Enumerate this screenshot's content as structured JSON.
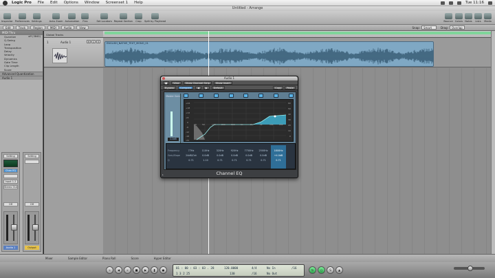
{
  "menubar": {
    "items": [
      "Logic Pro",
      "File",
      "Edit",
      "Options",
      "Window",
      "Screenset 1",
      "Help"
    ],
    "clock": "Tue 11:16"
  },
  "window": {
    "title": "Untitled - Arrange"
  },
  "toolbar": {
    "left": [
      "Inspector",
      "Preferences",
      "Settings",
      "Auto Zoom",
      "Automation",
      "Flex",
      "Set Locators",
      "Repeat Section",
      "Crop",
      "Split by Playhead"
    ],
    "right": [
      "Bounce",
      "Colors",
      "Notes",
      "Lists",
      "Media"
    ]
  },
  "local_menus": [
    "Edit",
    "Track",
    "Region",
    "MIDI",
    "Audio",
    "View"
  ],
  "snap": {
    "snap_label": "Snap:",
    "snap_value": "Smart",
    "drag_label": "Drag:",
    "drag_value": "Overlap"
  },
  "inspector": {
    "header": "MIDI Thru",
    "params": [
      {
        "label": "Quantize",
        "value": "off (3840)"
      },
      {
        "label": "Q-Swing",
        "value": ""
      },
      {
        "label": "Loop",
        "value": ""
      },
      {
        "label": "Transposition",
        "value": ""
      },
      {
        "label": "Delay",
        "value": ""
      },
      {
        "label": "Velocity",
        "value": ""
      },
      {
        "label": "Dynamics",
        "value": ""
      },
      {
        "label": "Gate Time",
        "value": ""
      },
      {
        "label": "Clip Length",
        "value": ""
      },
      {
        "label": "Score",
        "value": ""
      }
    ],
    "advanced": "Advanced Quantization",
    "track_section": "Audio 1",
    "strip1": {
      "setting": "Setting",
      "eq": "Chan EQ",
      "io": "Input 1-2",
      "group": "Stereo Out",
      "off": "Off",
      "name": "Audio 1"
    },
    "strip2": {
      "setting": "Setting",
      "off": "Off",
      "name": "Output"
    }
  },
  "arrange": {
    "tracklist_title": "Global Tracks",
    "track": {
      "number": "1",
      "name": "Audio 1",
      "mute": "M",
      "solo": "S",
      "rec": "R"
    },
    "region_name": "ENGLISH_NATIVE_TEXT_MONO_01"
  },
  "plugin": {
    "title": "Audio 1",
    "row1": [
      "View",
      "Show Channel Strip",
      "Show Insert"
    ],
    "row2": [
      "Bypass",
      "Compare",
      "Default"
    ],
    "row2_right": [
      "Copy",
      "Paste"
    ],
    "master_label": "Master Gain",
    "master_value": "0.0dB",
    "analyzer": "Analyzer",
    "analyzer2": "post EQ",
    "analyzer3": "Lock",
    "db_left": [
      "+24",
      "+18",
      "+12",
      "+6",
      "0",
      "-6",
      "-12",
      "-18",
      "-24"
    ],
    "db_right": [
      "60",
      "50",
      "40",
      "30",
      "20",
      "10",
      "0"
    ],
    "freq": [
      "20",
      "50",
      "100",
      "200",
      "500",
      "1k",
      "2k",
      "5k",
      "10k",
      "20k"
    ],
    "row_labels": [
      "Frequency",
      "Gain/Slope",
      "Q"
    ],
    "bands": [
      {
        "f": "77Hz",
        "g": "24dB/Oct",
        "q": "0.71"
      },
      {
        "f": "110Hz",
        "g": "0.0dB",
        "q": "1.10"
      },
      {
        "f": "320Hz",
        "g": "0.0dB",
        "q": "0.71"
      },
      {
        "f": "920Hz",
        "g": "0.0dB",
        "q": "0.71"
      },
      {
        "f": "7750Hz",
        "g": "0.0dB",
        "q": "0.71"
      },
      {
        "f": "2500Hz",
        "g": "0.0dB",
        "q": "0.71"
      },
      {
        "f": "1800Hz",
        "g": "+4.0dB",
        "q": "0.71"
      },
      {
        "f": "",
        "g": "",
        "q": ""
      }
    ],
    "name": "Channel EQ"
  },
  "bottom_tabs": [
    "Mixer",
    "Sample Editor",
    "Piano Roll",
    "Score",
    "Hyper Editor"
  ],
  "transport": {
    "pos1": "01 : 00 : 03 : 03 . 28",
    "pos2": "1   3   2   25",
    "tempo": "120.0000",
    "sig": "4/4",
    "in": "No In",
    "out": "No Out",
    "ticks": "/16",
    "bpm": "130",
    "div": "/16"
  }
}
